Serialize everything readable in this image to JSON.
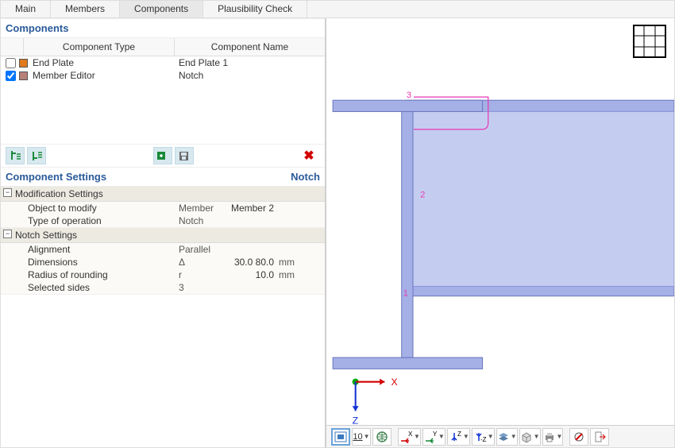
{
  "tabs": [
    "Main",
    "Members",
    "Components",
    "Plausibility Check"
  ],
  "active_tab_index": 2,
  "components_panel": {
    "title": "Components",
    "headers": {
      "type": "Component Type",
      "name": "Component Name"
    },
    "rows": [
      {
        "checked": false,
        "swatch": "#e07a1f",
        "type": "End Plate",
        "name": "End Plate 1"
      },
      {
        "checked": true,
        "swatch": "#b88078",
        "type": "Member Editor",
        "name": "Notch"
      }
    ]
  },
  "settings_panel": {
    "title": "Component Settings",
    "subtitle_right": "Notch",
    "groups": [
      {
        "title": "Modification Settings",
        "rows": [
          {
            "label": "Object to modify",
            "sym": "Member",
            "value": "Member 2",
            "unit": ""
          },
          {
            "label": "Type of operation",
            "sym": "Notch",
            "value": "",
            "unit": ""
          }
        ]
      },
      {
        "title": "Notch Settings",
        "rows": [
          {
            "label": "Alignment",
            "sym": "Parallel",
            "value": "",
            "unit": ""
          },
          {
            "label": "Dimensions",
            "sym": "Δ",
            "value": "30.0 80.0",
            "unit": "mm"
          },
          {
            "label": "Radius of rounding",
            "sym": "r",
            "value": "10.0",
            "unit": "mm"
          },
          {
            "label": "Selected sides",
            "sym": "3",
            "value": "",
            "unit": ""
          }
        ]
      }
    ]
  },
  "viewport": {
    "axis_labels": {
      "x": "X",
      "z": "Z"
    },
    "node_labels": [
      "1",
      "2",
      "3"
    ]
  },
  "bottom_toolbar": {
    "items": [
      "view-mode",
      "scale-10",
      "globe",
      "axis-x",
      "axis-y",
      "axis-z",
      "axis-neg-z",
      "layers",
      "cube",
      "print",
      "flag",
      "exit"
    ],
    "scale_label": "10"
  },
  "icons": {
    "move_left": "⇤",
    "move_right": "⇥",
    "add": "➕",
    "save": "💾",
    "delete": "✖"
  },
  "colors": {
    "accent": "#2a5a9a",
    "beam_fill": "#a4b0e6",
    "beam_stroke": "#6b76bf",
    "notch": "#e838b5"
  }
}
